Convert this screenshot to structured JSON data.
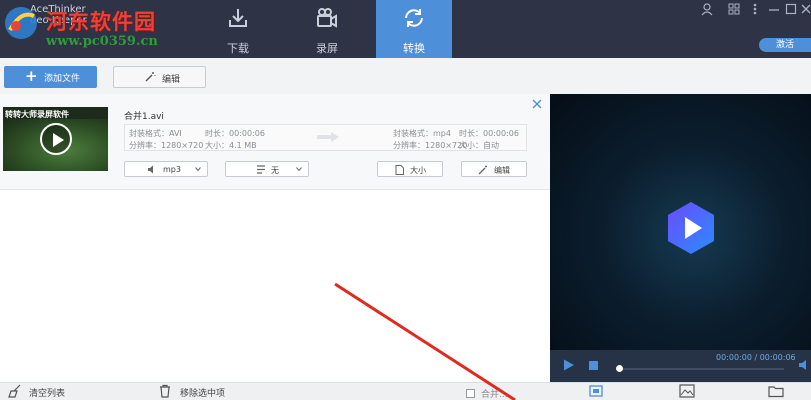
{
  "app": {
    "brand_line1": "AceThinker",
    "brand_line2": "deo Keeper"
  },
  "watermark": {
    "title": "河东软件园",
    "url": "www.pc0359.cn"
  },
  "nav": {
    "tabs": [
      {
        "label": "下载",
        "icon": "download-icon"
      },
      {
        "label": "录屏",
        "icon": "camera-icon"
      },
      {
        "label": "转换",
        "icon": "convert-icon",
        "active": true
      }
    ]
  },
  "titlebar": {
    "activate_label": "激活"
  },
  "toolbar": {
    "add_label": "添加文件",
    "edit_label": "编辑"
  },
  "file": {
    "name": "合并1.avi",
    "thumb_caption": "转转大师录屏软件",
    "source": {
      "format": "封装格式：AVI",
      "duration": "时长：00:00:06",
      "resolution": "分辨率：1280×720",
      "size": "大小：4.1 MB"
    },
    "target": {
      "format": "封装格式：mp4",
      "duration": "时长：00:00:06",
      "resolution": "分辨率：1280×720",
      "size": "大小：自动"
    },
    "output_format": "mp3",
    "subtitle": "无",
    "size_button": "大小",
    "edit_button": "编辑"
  },
  "player": {
    "time": "00:00:00 / 00:00:06",
    "progress": 0
  },
  "bottom": {
    "clear_label": "清空列表",
    "remove_label": "移除选中项",
    "merge_label": "合并..."
  },
  "colors": {
    "accent": "#4d8fd9",
    "titlebar": "#2e3445",
    "annotation": "#e02a1e"
  }
}
